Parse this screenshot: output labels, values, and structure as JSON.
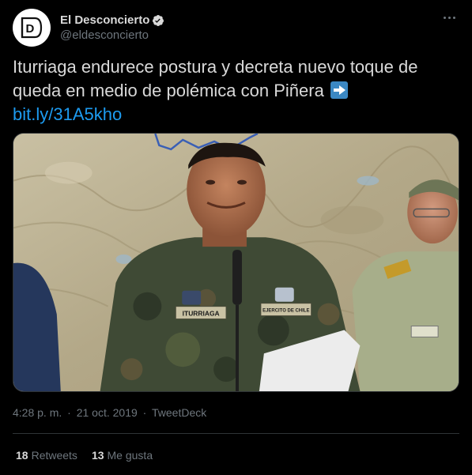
{
  "account": {
    "display_name": "El Desconcierto",
    "handle": "@eldesconcierto",
    "avatar_letter": "D"
  },
  "tweet": {
    "text": "Iturriaga endurece postura y decreta nuevo toque de queda en medio de polémica con Piñera",
    "emoji": "arrow-right-emoji",
    "link": "bit.ly/31A5kho"
  },
  "media": {
    "name_tag": "ITURRIAGA",
    "unit_tag": "EJERCITO DE CHILE"
  },
  "meta": {
    "time": "4:28 p. m.",
    "dot": "·",
    "date": "21 oct. 2019",
    "source": "TweetDeck"
  },
  "stats": {
    "retweets_count": "18",
    "retweets_label": "Retweets",
    "likes_count": "13",
    "likes_label": "Me gusta"
  },
  "colors": {
    "background": "#000000",
    "text": "#d9d9d9",
    "muted": "#6e767d",
    "link": "#1d9bf0",
    "border": "#2f3336",
    "verified": "#d9d9d9"
  }
}
